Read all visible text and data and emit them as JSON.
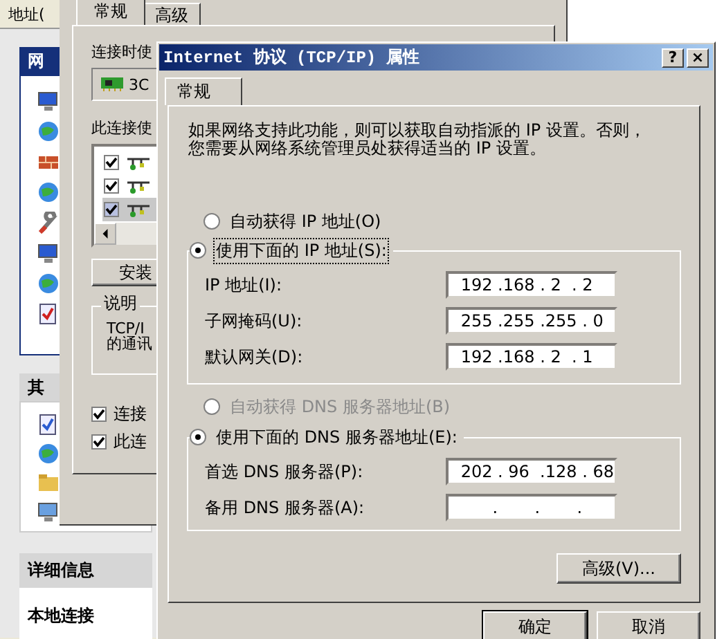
{
  "explorer": {
    "address_label": "地址(",
    "tasks_header": "网",
    "other_header": "其",
    "details_header": "详细信息",
    "details_title": "本地连接"
  },
  "properties_window": {
    "tabs": [
      {
        "label": "常规",
        "selected": true
      },
      {
        "label": "高级",
        "selected": false
      }
    ],
    "connect_using_label": "连接时使",
    "adapter": "3C",
    "components_label": "此连接使",
    "components": [
      {
        "checked": true,
        "selected": false
      },
      {
        "checked": true,
        "selected": false
      },
      {
        "checked": true,
        "selected": true
      }
    ],
    "install_button": "安装",
    "description_group": "说明",
    "description_lines": [
      "TCP/I",
      "的通讯"
    ],
    "options": [
      {
        "label": "连接",
        "checked": true
      },
      {
        "label": "此连",
        "checked": true
      }
    ]
  },
  "dialog": {
    "title": "Internet 协议 (TCP/IP) 属性",
    "title_buttons": [
      "?",
      "×"
    ],
    "tabs": [
      {
        "label": "常规",
        "selected": true
      }
    ],
    "intro_lines": [
      "如果网络支持此功能，则可以获取自动指派的 IP 设置。否则，",
      "您需要从网络系统管理员处获得适当的 IP 设置。"
    ],
    "ip_radios": [
      {
        "label": "自动获得 IP 地址(O)",
        "selected": false,
        "disabled": false,
        "focused": false
      },
      {
        "label": "使用下面的 IP 地址(S):",
        "selected": true,
        "disabled": false,
        "focused": true
      }
    ],
    "ip_fields": [
      {
        "label": "IP 地址(I):",
        "value": " 192 .168 . 2  . 2"
      },
      {
        "label": "子网掩码(U):",
        "value": " 255 .255 .255 . 0"
      },
      {
        "label": "默认网关(D):",
        "value": " 192 .168 . 2  . 1"
      }
    ],
    "dns_radios": [
      {
        "label": "自动获得 DNS 服务器地址(B)",
        "selected": false,
        "disabled": true,
        "focused": false
      },
      {
        "label": "使用下面的 DNS 服务器地址(E):",
        "selected": true,
        "disabled": false,
        "focused": false
      }
    ],
    "dns_fields": [
      {
        "label": "首选 DNS 服务器(P):",
        "value": " 202 . 96  .128 . 68"
      },
      {
        "label": "备用 DNS 服务器(A):",
        "value": "       .       .       ."
      }
    ],
    "advanced_button": "高级(V)...",
    "ok_button": "确定",
    "cancel_button": "取消"
  }
}
